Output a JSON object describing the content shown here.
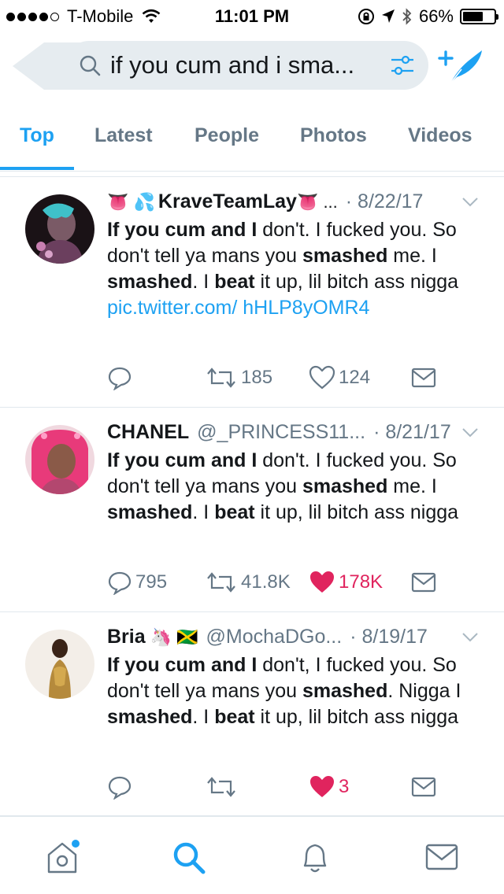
{
  "status_bar": {
    "carrier": "T-Mobile",
    "time": "11:01 PM",
    "battery": "66%",
    "battery_level": 0.66
  },
  "search": {
    "query": "if you cum and i sma..."
  },
  "tabs": [
    {
      "label": "Top",
      "active": true
    },
    {
      "label": "Latest",
      "active": false
    },
    {
      "label": "People",
      "active": false
    },
    {
      "label": "Photos",
      "active": false
    },
    {
      "label": "Videos",
      "active": false
    }
  ],
  "tweets": [
    {
      "name": "KraveTeamLay",
      "name_emojis_before": "👅 💦",
      "name_emojis_after": "👅 ...",
      "handle": "",
      "date": "· 8/22/17",
      "body_parts": [
        {
          "text": "If you cum and I",
          "bold": true
        },
        {
          "text": " don't. I fucked you. So don't tell ya mans you ",
          "bold": false
        },
        {
          "text": "smashed",
          "bold": true
        },
        {
          "text": " me. I ",
          "bold": false
        },
        {
          "text": "smashed",
          "bold": true
        },
        {
          "text": ". I ",
          "bold": false
        },
        {
          "text": "beat",
          "bold": true
        },
        {
          "text": " it up, lil bitch ass nigga ",
          "bold": false
        }
      ],
      "link": "pic.twitter.com/ hHLP8yOMR4",
      "replies": "",
      "retweets": "185",
      "likes": "124",
      "liked": false
    },
    {
      "name": "CHANEL",
      "handle": "@_PRINCESS11...",
      "date": "· 8/21/17",
      "body_parts": [
        {
          "text": "If you cum and I",
          "bold": true
        },
        {
          "text": " don't. I fucked you. So don't tell ya mans you ",
          "bold": false
        },
        {
          "text": "smashed",
          "bold": true
        },
        {
          "text": " me. I ",
          "bold": false
        },
        {
          "text": "smashed",
          "bold": true
        },
        {
          "text": ". I ",
          "bold": false
        },
        {
          "text": "beat",
          "bold": true
        },
        {
          "text": " it up, lil bitch ass nigga",
          "bold": false
        }
      ],
      "replies": "795",
      "retweets": "41.8K",
      "likes": "178K",
      "liked": true
    },
    {
      "name": "Bria",
      "name_emojis_after": "🦄 🇯🇲",
      "handle": "@MochaDGo...",
      "date": "· 8/19/17",
      "body_parts": [
        {
          "text": "If you cum and I",
          "bold": true
        },
        {
          "text": " don't, I fucked you. So don't tell ya mans you ",
          "bold": false
        },
        {
          "text": "smashed",
          "bold": true
        },
        {
          "text": ". Nigga I ",
          "bold": false
        },
        {
          "text": "smashed",
          "bold": true
        },
        {
          "text": ". I ",
          "bold": false
        },
        {
          "text": "beat",
          "bold": true
        },
        {
          "text": " it up, lil bitch ass nigga",
          "bold": false
        }
      ],
      "replies": "",
      "retweets": "",
      "likes": "3",
      "liked": true
    }
  ],
  "colors": {
    "accent": "#1da1f2",
    "like": "#e0245e",
    "muted": "#657786"
  },
  "bottom_nav": [
    "home-icon",
    "search-icon",
    "notifications-icon",
    "messages-icon"
  ]
}
